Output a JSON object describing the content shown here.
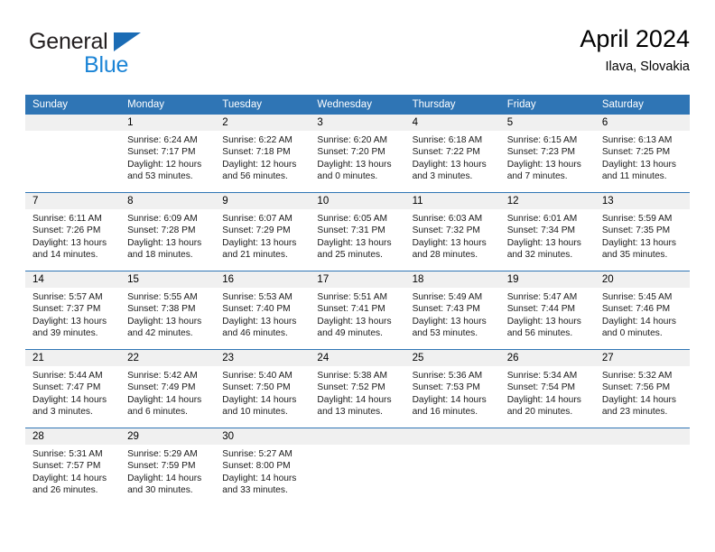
{
  "brand": {
    "name_part1": "General",
    "name_part2": "Blue",
    "triangle_icon": "triangle-icon",
    "color_dark": "#231f20",
    "color_blue": "#1b84d6"
  },
  "header": {
    "title": "April 2024",
    "subtitle": "Ilava, Slovakia",
    "accent_color": "#2f75b5"
  },
  "calendar": {
    "weekday_headers": [
      "Sunday",
      "Monday",
      "Tuesday",
      "Wednesday",
      "Thursday",
      "Friday",
      "Saturday"
    ],
    "weeks": [
      [
        {
          "day": "",
          "empty": true,
          "sunrise": "",
          "sunset": "",
          "daylight_line1": "",
          "daylight_line2": ""
        },
        {
          "day": "1",
          "empty": false,
          "sunrise": "Sunrise: 6:24 AM",
          "sunset": "Sunset: 7:17 PM",
          "daylight_line1": "Daylight: 12 hours",
          "daylight_line2": "and 53 minutes."
        },
        {
          "day": "2",
          "empty": false,
          "sunrise": "Sunrise: 6:22 AM",
          "sunset": "Sunset: 7:18 PM",
          "daylight_line1": "Daylight: 12 hours",
          "daylight_line2": "and 56 minutes."
        },
        {
          "day": "3",
          "empty": false,
          "sunrise": "Sunrise: 6:20 AM",
          "sunset": "Sunset: 7:20 PM",
          "daylight_line1": "Daylight: 13 hours",
          "daylight_line2": "and 0 minutes."
        },
        {
          "day": "4",
          "empty": false,
          "sunrise": "Sunrise: 6:18 AM",
          "sunset": "Sunset: 7:22 PM",
          "daylight_line1": "Daylight: 13 hours",
          "daylight_line2": "and 3 minutes."
        },
        {
          "day": "5",
          "empty": false,
          "sunrise": "Sunrise: 6:15 AM",
          "sunset": "Sunset: 7:23 PM",
          "daylight_line1": "Daylight: 13 hours",
          "daylight_line2": "and 7 minutes."
        },
        {
          "day": "6",
          "empty": false,
          "sunrise": "Sunrise: 6:13 AM",
          "sunset": "Sunset: 7:25 PM",
          "daylight_line1": "Daylight: 13 hours",
          "daylight_line2": "and 11 minutes."
        }
      ],
      [
        {
          "day": "7",
          "empty": false,
          "sunrise": "Sunrise: 6:11 AM",
          "sunset": "Sunset: 7:26 PM",
          "daylight_line1": "Daylight: 13 hours",
          "daylight_line2": "and 14 minutes."
        },
        {
          "day": "8",
          "empty": false,
          "sunrise": "Sunrise: 6:09 AM",
          "sunset": "Sunset: 7:28 PM",
          "daylight_line1": "Daylight: 13 hours",
          "daylight_line2": "and 18 minutes."
        },
        {
          "day": "9",
          "empty": false,
          "sunrise": "Sunrise: 6:07 AM",
          "sunset": "Sunset: 7:29 PM",
          "daylight_line1": "Daylight: 13 hours",
          "daylight_line2": "and 21 minutes."
        },
        {
          "day": "10",
          "empty": false,
          "sunrise": "Sunrise: 6:05 AM",
          "sunset": "Sunset: 7:31 PM",
          "daylight_line1": "Daylight: 13 hours",
          "daylight_line2": "and 25 minutes."
        },
        {
          "day": "11",
          "empty": false,
          "sunrise": "Sunrise: 6:03 AM",
          "sunset": "Sunset: 7:32 PM",
          "daylight_line1": "Daylight: 13 hours",
          "daylight_line2": "and 28 minutes."
        },
        {
          "day": "12",
          "empty": false,
          "sunrise": "Sunrise: 6:01 AM",
          "sunset": "Sunset: 7:34 PM",
          "daylight_line1": "Daylight: 13 hours",
          "daylight_line2": "and 32 minutes."
        },
        {
          "day": "13",
          "empty": false,
          "sunrise": "Sunrise: 5:59 AM",
          "sunset": "Sunset: 7:35 PM",
          "daylight_line1": "Daylight: 13 hours",
          "daylight_line2": "and 35 minutes."
        }
      ],
      [
        {
          "day": "14",
          "empty": false,
          "sunrise": "Sunrise: 5:57 AM",
          "sunset": "Sunset: 7:37 PM",
          "daylight_line1": "Daylight: 13 hours",
          "daylight_line2": "and 39 minutes."
        },
        {
          "day": "15",
          "empty": false,
          "sunrise": "Sunrise: 5:55 AM",
          "sunset": "Sunset: 7:38 PM",
          "daylight_line1": "Daylight: 13 hours",
          "daylight_line2": "and 42 minutes."
        },
        {
          "day": "16",
          "empty": false,
          "sunrise": "Sunrise: 5:53 AM",
          "sunset": "Sunset: 7:40 PM",
          "daylight_line1": "Daylight: 13 hours",
          "daylight_line2": "and 46 minutes."
        },
        {
          "day": "17",
          "empty": false,
          "sunrise": "Sunrise: 5:51 AM",
          "sunset": "Sunset: 7:41 PM",
          "daylight_line1": "Daylight: 13 hours",
          "daylight_line2": "and 49 minutes."
        },
        {
          "day": "18",
          "empty": false,
          "sunrise": "Sunrise: 5:49 AM",
          "sunset": "Sunset: 7:43 PM",
          "daylight_line1": "Daylight: 13 hours",
          "daylight_line2": "and 53 minutes."
        },
        {
          "day": "19",
          "empty": false,
          "sunrise": "Sunrise: 5:47 AM",
          "sunset": "Sunset: 7:44 PM",
          "daylight_line1": "Daylight: 13 hours",
          "daylight_line2": "and 56 minutes."
        },
        {
          "day": "20",
          "empty": false,
          "sunrise": "Sunrise: 5:45 AM",
          "sunset": "Sunset: 7:46 PM",
          "daylight_line1": "Daylight: 14 hours",
          "daylight_line2": "and 0 minutes."
        }
      ],
      [
        {
          "day": "21",
          "empty": false,
          "sunrise": "Sunrise: 5:44 AM",
          "sunset": "Sunset: 7:47 PM",
          "daylight_line1": "Daylight: 14 hours",
          "daylight_line2": "and 3 minutes."
        },
        {
          "day": "22",
          "empty": false,
          "sunrise": "Sunrise: 5:42 AM",
          "sunset": "Sunset: 7:49 PM",
          "daylight_line1": "Daylight: 14 hours",
          "daylight_line2": "and 6 minutes."
        },
        {
          "day": "23",
          "empty": false,
          "sunrise": "Sunrise: 5:40 AM",
          "sunset": "Sunset: 7:50 PM",
          "daylight_line1": "Daylight: 14 hours",
          "daylight_line2": "and 10 minutes."
        },
        {
          "day": "24",
          "empty": false,
          "sunrise": "Sunrise: 5:38 AM",
          "sunset": "Sunset: 7:52 PM",
          "daylight_line1": "Daylight: 14 hours",
          "daylight_line2": "and 13 minutes."
        },
        {
          "day": "25",
          "empty": false,
          "sunrise": "Sunrise: 5:36 AM",
          "sunset": "Sunset: 7:53 PM",
          "daylight_line1": "Daylight: 14 hours",
          "daylight_line2": "and 16 minutes."
        },
        {
          "day": "26",
          "empty": false,
          "sunrise": "Sunrise: 5:34 AM",
          "sunset": "Sunset: 7:54 PM",
          "daylight_line1": "Daylight: 14 hours",
          "daylight_line2": "and 20 minutes."
        },
        {
          "day": "27",
          "empty": false,
          "sunrise": "Sunrise: 5:32 AM",
          "sunset": "Sunset: 7:56 PM",
          "daylight_line1": "Daylight: 14 hours",
          "daylight_line2": "and 23 minutes."
        }
      ],
      [
        {
          "day": "28",
          "empty": false,
          "sunrise": "Sunrise: 5:31 AM",
          "sunset": "Sunset: 7:57 PM",
          "daylight_line1": "Daylight: 14 hours",
          "daylight_line2": "and 26 minutes."
        },
        {
          "day": "29",
          "empty": false,
          "sunrise": "Sunrise: 5:29 AM",
          "sunset": "Sunset: 7:59 PM",
          "daylight_line1": "Daylight: 14 hours",
          "daylight_line2": "and 30 minutes."
        },
        {
          "day": "30",
          "empty": false,
          "sunrise": "Sunrise: 5:27 AM",
          "sunset": "Sunset: 8:00 PM",
          "daylight_line1": "Daylight: 14 hours",
          "daylight_line2": "and 33 minutes."
        },
        {
          "day": "",
          "empty": true,
          "sunrise": "",
          "sunset": "",
          "daylight_line1": "",
          "daylight_line2": ""
        },
        {
          "day": "",
          "empty": true,
          "sunrise": "",
          "sunset": "",
          "daylight_line1": "",
          "daylight_line2": ""
        },
        {
          "day": "",
          "empty": true,
          "sunrise": "",
          "sunset": "",
          "daylight_line1": "",
          "daylight_line2": ""
        },
        {
          "day": "",
          "empty": true,
          "sunrise": "",
          "sunset": "",
          "daylight_line1": "",
          "daylight_line2": ""
        }
      ]
    ]
  }
}
